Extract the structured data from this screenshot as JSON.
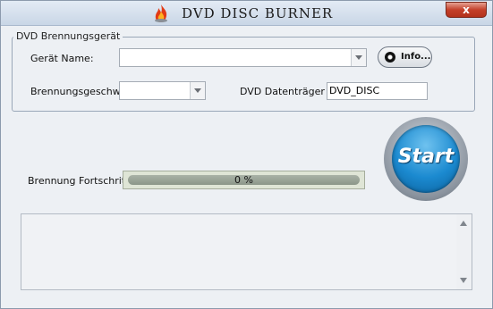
{
  "window": {
    "title": "DVD DISC BURNER",
    "close_label": "x"
  },
  "group": {
    "legend": "DVD Brennungsgerät",
    "device_label": "Gerät Name:",
    "device_value": "",
    "speed_label": "Brennungsgeschwindigkeit:",
    "speed_value": "",
    "volume_label": "DVD Datenträger Label:",
    "volume_value": "DVD_DISC",
    "info_button": "Info..."
  },
  "progress": {
    "label": "Brennung Fortschritt:",
    "value_text": "0 %",
    "value": 0
  },
  "start_button": "Start",
  "log": {
    "text": ""
  },
  "colors": {
    "accent": "#1b8ad0",
    "progress_fill": "#3fae3a",
    "close": "#c4402a"
  },
  "icons": {
    "title": "flame-icon",
    "info": "disc-icon"
  }
}
